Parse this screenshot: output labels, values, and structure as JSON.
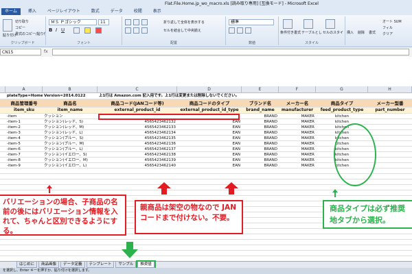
{
  "window": {
    "title": "Flat.File.Home.jp_wo_macro.xls [読み取り専用] [互換モード] - Microsoft Excel"
  },
  "ribbon": {
    "tabs": [
      "ホーム",
      "挿入",
      "ページレイアウト",
      "数式",
      "データ",
      "校閲",
      "表示"
    ],
    "font_name": "ＭＳ Ｐゴシック",
    "font_size": "11",
    "number_format": "標準",
    "labels": {
      "cut": "切り取り",
      "copy": "コピー",
      "format_painter": "書式のコピー/貼り付け",
      "paste": "貼り付け",
      "clipboard": "クリップボード",
      "font": "フォント",
      "wrap": "折り返して全体を表示する",
      "merge": "セルを結合して中央揃え",
      "alignment": "配置",
      "number": "数値",
      "cond_format": "条件付き書式",
      "table_format": "テーブルとして書式設定",
      "cell_style": "セルのスタイル",
      "styles": "スタイル",
      "insert": "挿入",
      "delete": "削除",
      "format": "書式",
      "autosum": "オート SUM",
      "fill": "フィル",
      "clear": "クリア"
    }
  },
  "formula_bar": {
    "cell": "CN15",
    "fx": "fx"
  },
  "columns": [
    "A",
    "B",
    "C",
    "D",
    "E",
    "F",
    "G",
    "H"
  ],
  "sheet": {
    "meta": [
      "plateType=Home",
      "Version=2014.0122",
      "上1行は Amazon.com 記入用です。上1行は変更または削除しないでください。"
    ],
    "header_jp": [
      "商品管理番号",
      "商品名",
      "商品コード(JANコード等)",
      "商品コードのタイプ",
      "ブランド名",
      "メーカー名",
      "商品タイプ",
      "メーカー型番"
    ],
    "header_en": [
      "item_sku",
      "item_name",
      "external_product_id",
      "external_product_id_type",
      "brand_name",
      "manufacturer",
      "feed_product_type",
      "part_number"
    ],
    "rows": [
      {
        "sku": "-item",
        "name": "クッション",
        "code": "",
        "type": "",
        "brand": "BRAND",
        "maker": "MAKER",
        "ptype": "kitchen"
      },
      {
        "sku": "-item-1",
        "name": "クッション(レッド、S)",
        "code": "4565423462132",
        "type": "EAN",
        "brand": "BRAND",
        "maker": "MAKER",
        "ptype": "kitchen"
      },
      {
        "sku": "-item-2",
        "name": "クッション(レッド、M)",
        "code": "4565423462133",
        "type": "EAN",
        "brand": "BRAND",
        "maker": "MAKER",
        "ptype": "kitchen"
      },
      {
        "sku": "-item-3",
        "name": "クッション(レッド、L)",
        "code": "4565423462134",
        "type": "EAN",
        "brand": "BRAND",
        "maker": "MAKER",
        "ptype": "kitchen"
      },
      {
        "sku": "-item-4",
        "name": "クッション(ブルー、S)",
        "code": "4565423462135",
        "type": "EAN",
        "brand": "BRAND",
        "maker": "MAKER",
        "ptype": "kitchen"
      },
      {
        "sku": "-item-5",
        "name": "クッション(ブルー、M)",
        "code": "4565423462136",
        "type": "EAN",
        "brand": "BRAND",
        "maker": "MAKER",
        "ptype": "kitchen"
      },
      {
        "sku": "-item-6",
        "name": "クッション(ブルー、L)",
        "code": "4565423462137",
        "type": "EAN",
        "brand": "BRAND",
        "maker": "MAKER",
        "ptype": "kitchen"
      },
      {
        "sku": "-item-7",
        "name": "クッション(イエロー、S)",
        "code": "4565423462138",
        "type": "EAN",
        "brand": "BRAND",
        "maker": "MAKER",
        "ptype": "kitchen"
      },
      {
        "sku": "-item-8",
        "name": "クッション(イエロー、M)",
        "code": "4565423462139",
        "type": "EAN",
        "brand": "BRAND",
        "maker": "MAKER",
        "ptype": "kitchen"
      },
      {
        "sku": "-item-9",
        "name": "クッション(イエロー、L)",
        "code": "4565423462140",
        "type": "EAN",
        "brand": "BRAND",
        "maker": "MAKER",
        "ptype": "kitchen"
      }
    ]
  },
  "annotations": {
    "variation_note": "バリエーションの場合、子商品の名前の後にはバリエーション情報を入れて、ちゃんと区別できるようにする。",
    "parent_note": "親商品は架空の物なので JANコードまで付けない。不要。",
    "ptype_note": "商品タイプは必ず推奨地タブから選択。"
  },
  "sheet_tabs": [
    "はじめに",
    "商品画像",
    "データ定義",
    "テンプレート",
    "サンプル",
    "推奨値"
  ],
  "active_sheet_tab": "推奨値",
  "status_text": "を選択し、Enter キーを押すか、貼り付けを選択します。",
  "colors": {
    "red": "#e31b23",
    "green": "#2bb24c",
    "header_orange": "#f7d9b6"
  }
}
